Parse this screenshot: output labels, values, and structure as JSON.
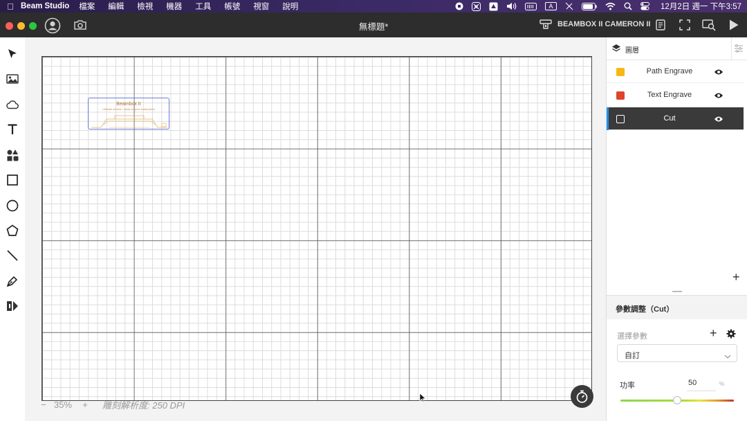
{
  "menubar": {
    "app_name": "Beam Studio",
    "items": [
      "檔案",
      "編輯",
      "檢視",
      "機器",
      "工具",
      "帳號",
      "視窗",
      "說明"
    ],
    "input_method": "A",
    "clock": "12月2日 週一 下午3:57"
  },
  "titlebar": {
    "doc_title": "無標題*",
    "machine_name": "BEAMBOX II CAMERON II"
  },
  "canvas": {
    "object_title": "Beambox II",
    "object_subtitle": "Ultimate medium, ready for your masterpiece",
    "zoom_minus": "−",
    "zoom_value": "35%",
    "zoom_plus": "+",
    "resolution": "雕刻解析度: 250 DPI"
  },
  "layers": {
    "panel_title": "圖層",
    "items": [
      {
        "name": "Path Engrave",
        "color": "#f5b816"
      },
      {
        "name": "Text Engrave",
        "color": "#e0432c"
      },
      {
        "name": "Cut",
        "color": "#3b4fd0"
      }
    ],
    "add_symbol": "+"
  },
  "params": {
    "title": "參數調整（Cut）",
    "preset_label": "選擇參數",
    "preset_add_symbol": "+",
    "preset_value": "自訂",
    "power_label": "功率",
    "power_value": "50",
    "power_unit": "%",
    "power_fraction": 0.5
  },
  "colors": {
    "accent": "#1e8ff0",
    "titlebar": "#2d2d2d",
    "selected_row": "#3a3a3a"
  }
}
